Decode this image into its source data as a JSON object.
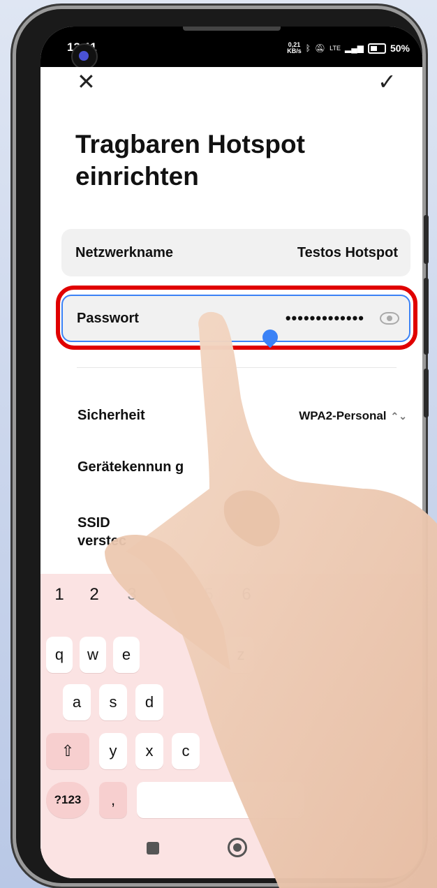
{
  "status_bar": {
    "time": "13:11",
    "net_speed_value": "0,21",
    "net_speed_unit": "KB/s",
    "network": "LTE",
    "battery": "50%"
  },
  "header": {
    "title_line1": "Tragbaren Hotspot",
    "title_line2": "einrichten"
  },
  "fields": {
    "network_name_label": "Netzwerkname",
    "network_name_value": "Testos Hotspot",
    "password_label": "Passwort",
    "password_value": "•••••••••••••"
  },
  "settings": {
    "security_label": "Sicherheit",
    "security_value": "WPA2-Personal",
    "device_id_label": "Gerätekennun g",
    "ssid_label": "SSID verstec"
  },
  "keyboard": {
    "numbers": [
      "1",
      "2",
      "3",
      "5",
      "6"
    ],
    "row1": [
      "q",
      "w",
      "e",
      "z"
    ],
    "row2": [
      "a",
      "s",
      "d"
    ],
    "row3": [
      "y",
      "x",
      "c"
    ],
    "symbols_key": "?123",
    "comma_key": ","
  },
  "colors": {
    "highlight": "#e00000",
    "accent": "#3b82f6",
    "keyboard_bg": "#fbe3e3"
  }
}
